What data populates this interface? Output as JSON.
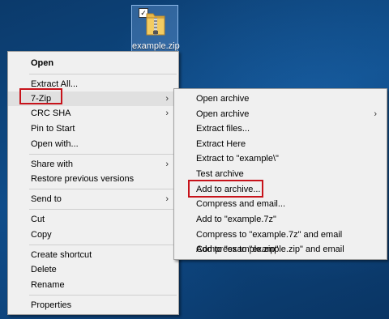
{
  "desktop": {
    "icon_label": "example.zip",
    "icon_name": "zip-folder-icon",
    "check_glyph": "✓"
  },
  "context_menu": {
    "items": [
      {
        "label": "Open"
      },
      {
        "label": "Extract All..."
      },
      {
        "label": "7-Zip"
      },
      {
        "label": "CRC SHA"
      },
      {
        "label": "Pin to Start"
      },
      {
        "label": "Open with..."
      },
      {
        "label": "Share with"
      },
      {
        "label": "Restore previous versions"
      },
      {
        "label": "Send to"
      },
      {
        "label": "Cut"
      },
      {
        "label": "Copy"
      },
      {
        "label": "Create shortcut"
      },
      {
        "label": "Delete"
      },
      {
        "label": "Rename"
      },
      {
        "label": "Properties"
      }
    ],
    "arrow_glyph": "›"
  },
  "submenu_7zip": {
    "items": [
      {
        "label": "Open archive"
      },
      {
        "label": "Open archive"
      },
      {
        "label": "Extract files..."
      },
      {
        "label": "Extract Here"
      },
      {
        "label": "Extract to \"example\\\""
      },
      {
        "label": "Test archive"
      },
      {
        "label": "Add to archive..."
      },
      {
        "label": "Compress and email..."
      },
      {
        "label": "Add to \"example.7z\""
      },
      {
        "label": "Compress to \"example.7z\" and email"
      },
      {
        "label": "Add to \"example.zip\""
      },
      {
        "label": "Compress to \"example.zip\" and email"
      }
    ]
  },
  "colors": {
    "highlight_border": "#c7131b",
    "menu_background": "#f0f0f0",
    "hover_background": "#e0e0e0"
  }
}
